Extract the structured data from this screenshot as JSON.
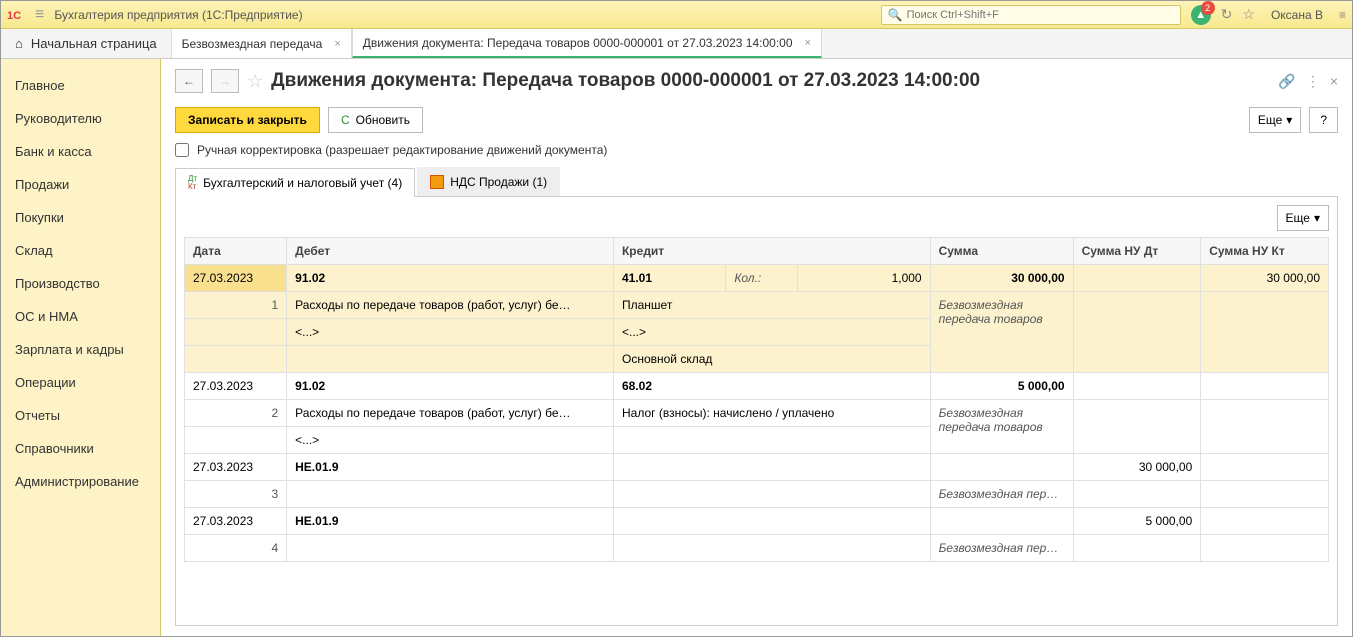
{
  "app": {
    "title": "Бухгалтерия предприятия  (1С:Предприятие)",
    "search_placeholder": "Поиск Ctrl+Shift+F",
    "bell_badge": "2",
    "user": "Оксана В"
  },
  "tabs": {
    "home": "Начальная страница",
    "items": [
      {
        "label": "Безвозмездная передача",
        "active": false
      },
      {
        "label": "Движения документа: Передача товаров 0000-000001 от 27.03.2023 14:00:00",
        "active": true
      }
    ]
  },
  "sidebar": [
    "Главное",
    "Руководителю",
    "Банк и касса",
    "Продажи",
    "Покупки",
    "Склад",
    "Производство",
    "ОС и НМА",
    "Зарплата и кадры",
    "Операции",
    "Отчеты",
    "Справочники",
    "Администрирование"
  ],
  "page": {
    "title": "Движения документа: Передача товаров 0000-000001 от 27.03.2023 14:00:00"
  },
  "toolbar": {
    "save_close": "Записать и закрыть",
    "refresh": "Обновить",
    "more": "Еще",
    "help": "?"
  },
  "checkbox": {
    "label": "Ручная корректировка (разрешает редактирование движений документа)"
  },
  "inner_tabs": [
    {
      "label": "Бухгалтерский и налоговый учет (4)",
      "active": true
    },
    {
      "label": "НДС Продажи (1)",
      "active": false
    }
  ],
  "table": {
    "more": "Еще",
    "headers": {
      "date": "Дата",
      "debit": "Дебет",
      "credit": "Кредит",
      "sum": "Сумма",
      "nu_dt": "Сумма НУ Дт",
      "nu_kt": "Сумма НУ Кт"
    },
    "rows": [
      {
        "highlight": true,
        "date": "27.03.2023",
        "num": "1",
        "debit_acc": "91.02",
        "debit_line2": "Расходы по передаче товаров (работ, услуг) бе…",
        "debit_line3": "<...>",
        "credit_acc": "41.01",
        "credit_qty_label": "Кол.:",
        "credit_qty": "1,000",
        "credit_line2": "Планшет",
        "credit_line3": "<...>",
        "credit_line4": "Основной склад",
        "sum": "30 000,00",
        "sum_note": "Безвозмездная передача товаров",
        "nu_dt": "",
        "nu_kt": "30 000,00"
      },
      {
        "highlight": false,
        "date": "27.03.2023",
        "num": "2",
        "debit_acc": "91.02",
        "debit_line2": "Расходы по передаче товаров (работ, услуг) бе…",
        "debit_line3": "<...>",
        "credit_acc": "68.02",
        "credit_line2": "Налог (взносы): начислено / уплачено",
        "sum": "5 000,00",
        "sum_note": "Безвозмездная передача товаров",
        "nu_dt": "",
        "nu_kt": ""
      },
      {
        "highlight": false,
        "date": "27.03.2023",
        "num": "3",
        "debit_acc": "НЕ.01.9",
        "sum": "",
        "sum_note": "Безвозмездная пер…",
        "nu_dt": "30 000,00",
        "nu_kt": ""
      },
      {
        "highlight": false,
        "date": "27.03.2023",
        "num": "4",
        "debit_acc": "НЕ.01.9",
        "sum": "",
        "sum_note": "Безвозмездная пер…",
        "nu_dt": "5 000,00",
        "nu_kt": ""
      }
    ]
  }
}
